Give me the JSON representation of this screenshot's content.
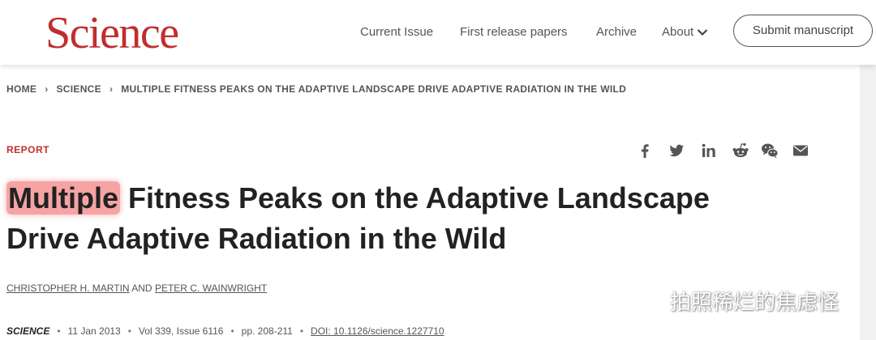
{
  "header": {
    "logo": "Science",
    "nav": [
      "Current Issue",
      "First release papers",
      "Archive",
      "About"
    ],
    "submit_label": "Submit manuscript"
  },
  "breadcrumb": [
    "HOME",
    "SCIENCE",
    "MULTIPLE FITNESS PEAKS ON THE ADAPTIVE LANDSCAPE DRIVE ADAPTIVE RADIATION IN THE WILD"
  ],
  "article": {
    "type": "REPORT",
    "title_highlight": "Multiple",
    "title_rest": " Fitness Peaks on the Adaptive Landscape Drive Adaptive Radiation in the Wild",
    "authors": [
      "CHRISTOPHER H. MARTIN",
      "PETER C. WAINWRIGHT"
    ],
    "authors_joiner": "AND",
    "journal": "SCIENCE",
    "date": "11 Jan 2013",
    "volume": "Vol 339, Issue 6116",
    "pages": "pp. 208-211",
    "doi": "DOI: 10.1126/science.1227710"
  },
  "share_icons": [
    "facebook-icon",
    "twitter-icon",
    "linkedin-icon",
    "reddit-icon",
    "wechat-icon",
    "email-icon"
  ],
  "watermark": "拍照稀烂的焦虑怪",
  "colors": {
    "brand": "#c02e2e",
    "highlight": "#f6a3a3",
    "text": "#222222"
  }
}
